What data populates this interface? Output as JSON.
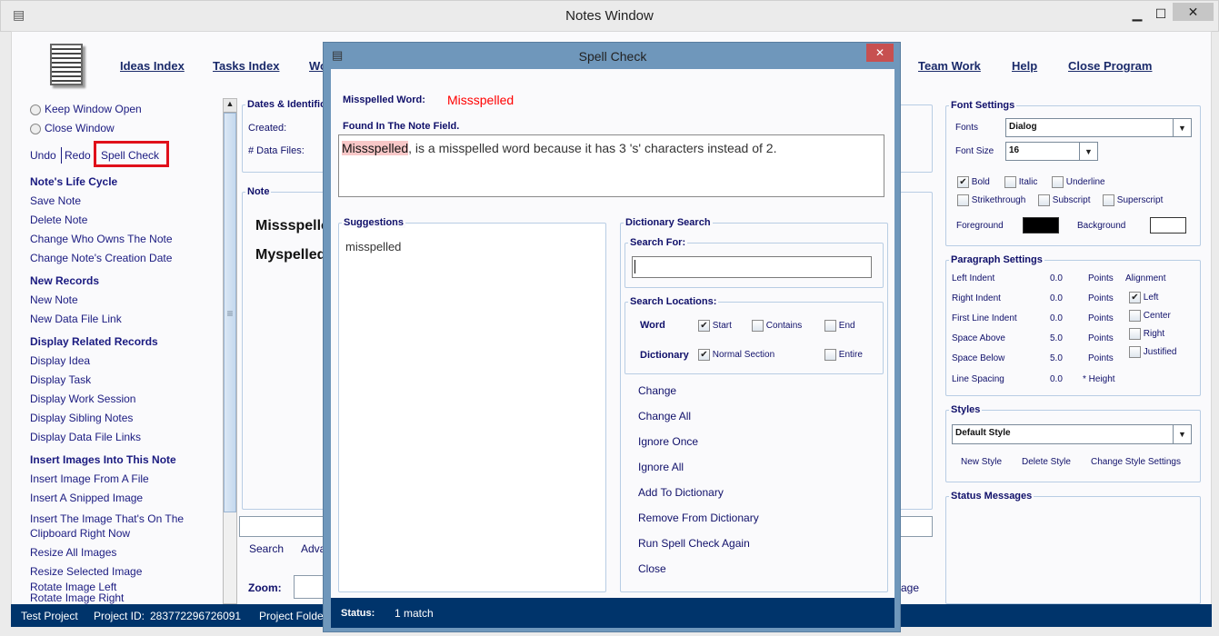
{
  "window": {
    "title": "Notes Window",
    "minimize": "▁",
    "maximize": "☐",
    "close": "✕"
  },
  "nav": [
    "Ideas Index",
    "Tasks Index",
    "Wo",
    "Team Work",
    "Help",
    "Close Program"
  ],
  "sidebar": {
    "radios": [
      "Keep Window Open",
      "Close Window"
    ],
    "edit": {
      "undo": "Undo",
      "redo": "Redo",
      "spell": "Spell Check"
    },
    "sections": [
      {
        "title": "Note's Life Cycle",
        "items": [
          "Save Note",
          "Delete Note",
          "Change Who Owns The Note",
          "Change Note's Creation Date"
        ]
      },
      {
        "title": "New Records",
        "items": [
          "New Note",
          "New Data File Link"
        ]
      },
      {
        "title": "Display Related Records",
        "items": [
          "Display Idea",
          "Display Task",
          "Display Work Session",
          "Display Sibling Notes",
          "Display Data File Links"
        ]
      },
      {
        "title": "Insert Images Into This Note",
        "items": [
          "Insert Image From A File",
          "Insert A Snipped Image",
          "Insert The Image That's On The Clipboard Right Now",
          "Resize All Images",
          "Resize Selected Image",
          "Rotate Image Left",
          "Rotate Image Right"
        ]
      }
    ]
  },
  "main": {
    "dates_title": "Dates & Identific",
    "created": "Created:",
    "data_files": "# Data Files:",
    "note_title": "Note",
    "note_lines": [
      "Missspelle",
      "Myspelled"
    ],
    "search": "Search",
    "advanced": "Adva",
    "zoom": "Zoom:",
    "right_tail": "age"
  },
  "font": {
    "title": "Font Settings",
    "fonts_label": "Fonts",
    "fonts_value": "Dialog",
    "size_label": "Font Size",
    "size_value": "16",
    "bold": "Bold",
    "italic": "Italic",
    "underline": "Underline",
    "strike": "Strikethrough",
    "sub": "Subscript",
    "sup": "Superscript",
    "fg": "Foreground",
    "bg": "Background",
    "fg_color": "#000000",
    "bg_color": "#ffffff"
  },
  "paragraph": {
    "title": "Paragraph Settings",
    "rows": [
      {
        "label": "Left Indent",
        "value": "0.0",
        "unit": "Points"
      },
      {
        "label": "Right Indent",
        "value": "0.0",
        "unit": "Points"
      },
      {
        "label": "First Line Indent",
        "value": "0.0",
        "unit": "Points"
      },
      {
        "label": "Space Above",
        "value": "5.0",
        "unit": "Points"
      },
      {
        "label": "Space Below",
        "value": "5.0",
        "unit": "Points"
      },
      {
        "label": "Line Spacing",
        "value": "0.0",
        "unit": "* Height"
      }
    ],
    "alignment": "Alignment",
    "align_options": [
      "Left",
      "Center",
      "Right",
      "Justified"
    ],
    "align_selected": "Left"
  },
  "styles": {
    "title": "Styles",
    "value": "Default Style",
    "new": "New Style",
    "delete": "Delete Style",
    "change": "Change Style Settings"
  },
  "status_messages": {
    "title": "Status Messages"
  },
  "statusbar": {
    "project": "Test Project",
    "id_label": "Project ID:",
    "id": "283772296726091",
    "folder": "Project Folde"
  },
  "dialog": {
    "title": "Spell Check",
    "close": "✕",
    "misspelled_label": "Misspelled Word:",
    "misspelled": "Missspelled",
    "found_label": "Found In The Note Field.",
    "context_word": "Missspelled",
    "context_rest": ", is a misspelled word because it has 3 's' characters instead of 2.",
    "suggestions_title": "Suggestions",
    "suggestions": [
      "misspelled"
    ],
    "dict_title": "Dictionary Search",
    "search_for": "Search For:",
    "search_value": "",
    "locations": "Search Locations:",
    "word": "Word",
    "start": "Start",
    "contains": "Contains",
    "end": "End",
    "dictionary": "Dictionary",
    "normal": "Normal Section",
    "entire": "Entire",
    "actions": [
      "Change",
      "Change All",
      "Ignore Once",
      "Ignore All",
      "Add To Dictionary",
      "Remove From Dictionary",
      "Run Spell Check Again",
      "Close"
    ],
    "status_label": "Status:",
    "status": "1 match",
    "highlight": "#f8c8c8",
    "misspelled_color": "#ff0000"
  }
}
